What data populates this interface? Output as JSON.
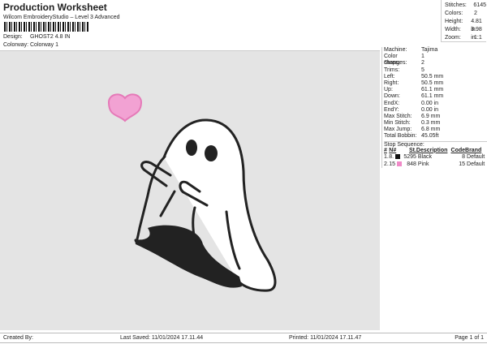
{
  "header": {
    "title": "Production Worksheet",
    "subtitle": "Wilcom EmbroideryStudio – Level 3 Advanced",
    "design_label": "Design:",
    "design": "GHOST2 4.8 IN",
    "colorway_label": "Colorway:",
    "colorway": "Colorway 1"
  },
  "stats": [
    {
      "k": "Stitches:",
      "v": "6145"
    },
    {
      "k": "Colors:",
      "v": "2"
    },
    {
      "k": "Height:",
      "v": "4.81 in"
    },
    {
      "k": "Width:",
      "v": "3.98 in"
    },
    {
      "k": "Zoom:",
      "v": "1:1"
    }
  ],
  "details": [
    {
      "k": "Machine:",
      "v": "Tajima"
    },
    {
      "k": "Color changes:",
      "v": "1"
    },
    {
      "k": "Stops:",
      "v": "2"
    },
    {
      "k": "Trims:",
      "v": "5"
    },
    {
      "k": "Left:",
      "v": "50.5 mm"
    },
    {
      "k": "Right:",
      "v": "50.5 mm"
    },
    {
      "k": "Up:",
      "v": "61.1 mm"
    },
    {
      "k": "Down:",
      "v": "61.1 mm"
    },
    {
      "k": "EndX:",
      "v": "0.00 in"
    },
    {
      "k": "EndY:",
      "v": "0.00 in"
    },
    {
      "k": "Max Stitch:",
      "v": "6.9 mm"
    },
    {
      "k": "Min Stitch:",
      "v": "0.3 mm"
    },
    {
      "k": "Max Jump:",
      "v": "6.8 mm"
    },
    {
      "k": "Total Bobbin:",
      "v": "45.05ft"
    }
  ],
  "stop_sequence": {
    "title": "Stop Sequence:",
    "headers": [
      "#",
      "N#",
      "St.",
      "Description",
      "Code",
      "Brand"
    ],
    "rows": [
      {
        "n": "1.",
        "needle": "8.",
        "color": "#111111",
        "st": "5295",
        "desc": "Black",
        "code": "8",
        "brand": "Default"
      },
      {
        "n": "2.",
        "needle": "15",
        "color": "#f08ac8",
        "st": "848",
        "desc": "Pink",
        "code": "15",
        "brand": "Default"
      }
    ]
  },
  "footer": {
    "created": "Created By:",
    "saved": "Last Saved: 11/01/2024 17.11.44",
    "printed": "Printed: 11/01/2024 17.11.47",
    "page": "Page 1 of 1"
  }
}
